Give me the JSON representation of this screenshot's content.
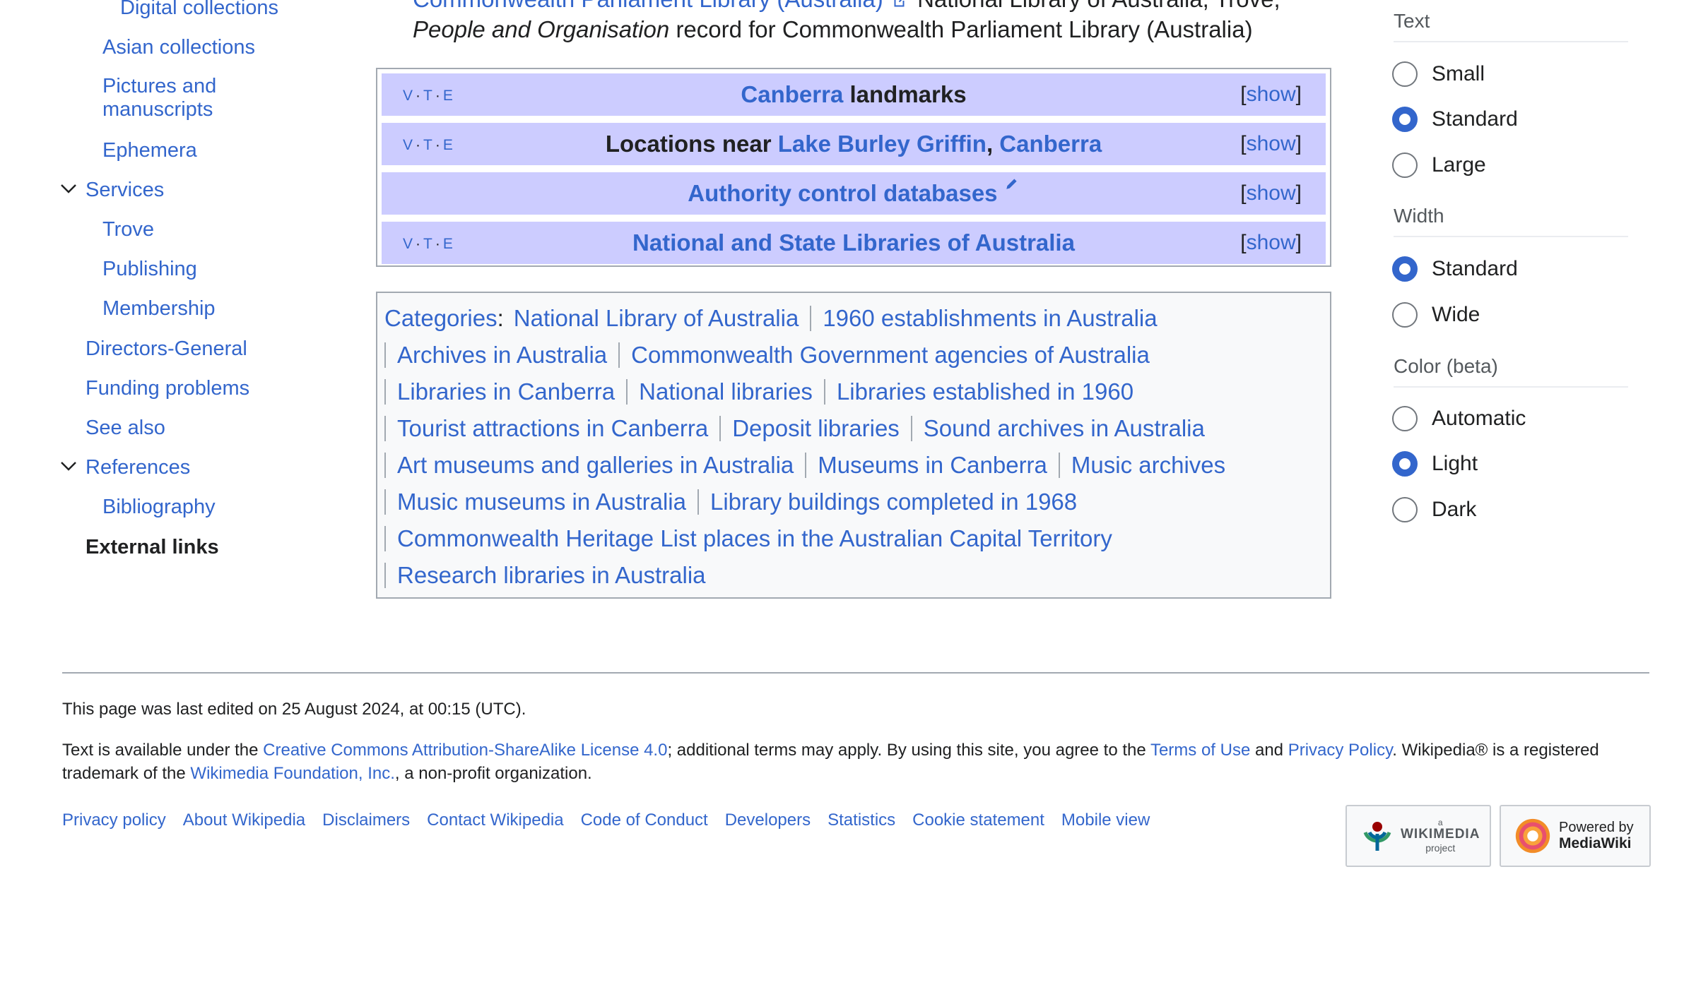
{
  "toc": {
    "items": [
      {
        "label": "Digital collections",
        "level": 3
      },
      {
        "label": "Asian collections",
        "level": 3
      },
      {
        "label": "Pictures and manuscripts",
        "level": 3
      },
      {
        "label": "Ephemera",
        "level": 3
      },
      {
        "label": "Services",
        "level": 2
      },
      {
        "label": "Trove",
        "level": 3
      },
      {
        "label": "Publishing",
        "level": 3
      },
      {
        "label": "Membership",
        "level": 3
      },
      {
        "label": "Directors-General",
        "level": 2
      },
      {
        "label": "Funding problems",
        "level": 2
      },
      {
        "label": "See also",
        "level": 2
      },
      {
        "label": "References",
        "level": 2
      },
      {
        "label": "Bibliography",
        "level": 3
      },
      {
        "label": "External links",
        "level": 2,
        "current": true
      }
    ]
  },
  "main": {
    "top_line_link": "Commonwealth Parliament Library (Australia)",
    "top_line_rest": "National Library of Australia, Trove,",
    "record_italic": "People and Organisation",
    "record_rest": "record for Commonwealth Parliament Library (Australia)",
    "vte": {
      "v": "V",
      "t": "T",
      "e": "E"
    },
    "show_label": "show",
    "navboxes": [
      {
        "link1": "Canberra",
        "text1": " landmarks"
      },
      {
        "text0": "Locations near ",
        "link1": "Lake Burley Griffin",
        "sep": ", ",
        "link2": "Canberra"
      },
      {
        "link1": "Authority control databases"
      },
      {
        "link1": "National and State Libraries of Australia"
      }
    ],
    "categories_label": "Categories",
    "categories": [
      [
        "National Library of Australia",
        "1960 establishments in Australia"
      ],
      [
        "Archives in Australia",
        "Commonwealth Government agencies of Australia"
      ],
      [
        "Libraries in Canberra",
        "National libraries",
        "Libraries established in 1960"
      ],
      [
        "Tourist attractions in Canberra",
        "Deposit libraries",
        "Sound archives in Australia"
      ],
      [
        "Art museums and galleries in Australia",
        "Museums in Canberra",
        "Music archives"
      ],
      [
        "Music museums in Australia",
        "Library buildings completed in 1968"
      ],
      [
        "Commonwealth Heritage List places in the Australian Capital Territory"
      ],
      [
        "Research libraries in Australia"
      ]
    ]
  },
  "appearance": {
    "text_heading": "Text",
    "text_options": [
      {
        "label": "Small",
        "checked": false
      },
      {
        "label": "Standard",
        "checked": true
      },
      {
        "label": "Large",
        "checked": false
      }
    ],
    "width_heading": "Width",
    "width_options": [
      {
        "label": "Standard",
        "checked": true
      },
      {
        "label": "Wide",
        "checked": false
      }
    ],
    "color_heading": "Color (beta)",
    "color_options": [
      {
        "label": "Automatic",
        "checked": false
      },
      {
        "label": "Light",
        "checked": true
      },
      {
        "label": "Dark",
        "checked": false
      }
    ]
  },
  "footer": {
    "last_edited": "This page was last edited on 25 August 2024, at 00:15 (UTC).",
    "license_pre": "Text is available under the ",
    "license_link": "Creative Commons Attribution-ShareAlike License 4.0",
    "license_mid": "; additional terms may apply. By using this site, you agree to the ",
    "terms_link": "Terms of Use",
    "and": " and ",
    "privacy_link": "Privacy Policy",
    "license_post": ". Wikipedia® is a registered trademark of the ",
    "foundation_link": "Wikimedia Foundation, Inc.",
    "license_end": ", a non-profit organization.",
    "links": [
      "Privacy policy",
      "About Wikipedia",
      "Disclaimers",
      "Contact Wikipedia",
      "Code of Conduct",
      "Developers",
      "Statistics",
      "Cookie statement",
      "Mobile view"
    ],
    "wikimedia_badge": {
      "small": "a",
      "name": "WIKIMEDIA",
      "sub": "project"
    },
    "mediawiki_badge": {
      "top": "Powered by",
      "name": "MediaWiki"
    }
  },
  "colors": {
    "link": "#3366cc",
    "navbox_bg": "#ccccff",
    "border": "#a2a9b1"
  }
}
